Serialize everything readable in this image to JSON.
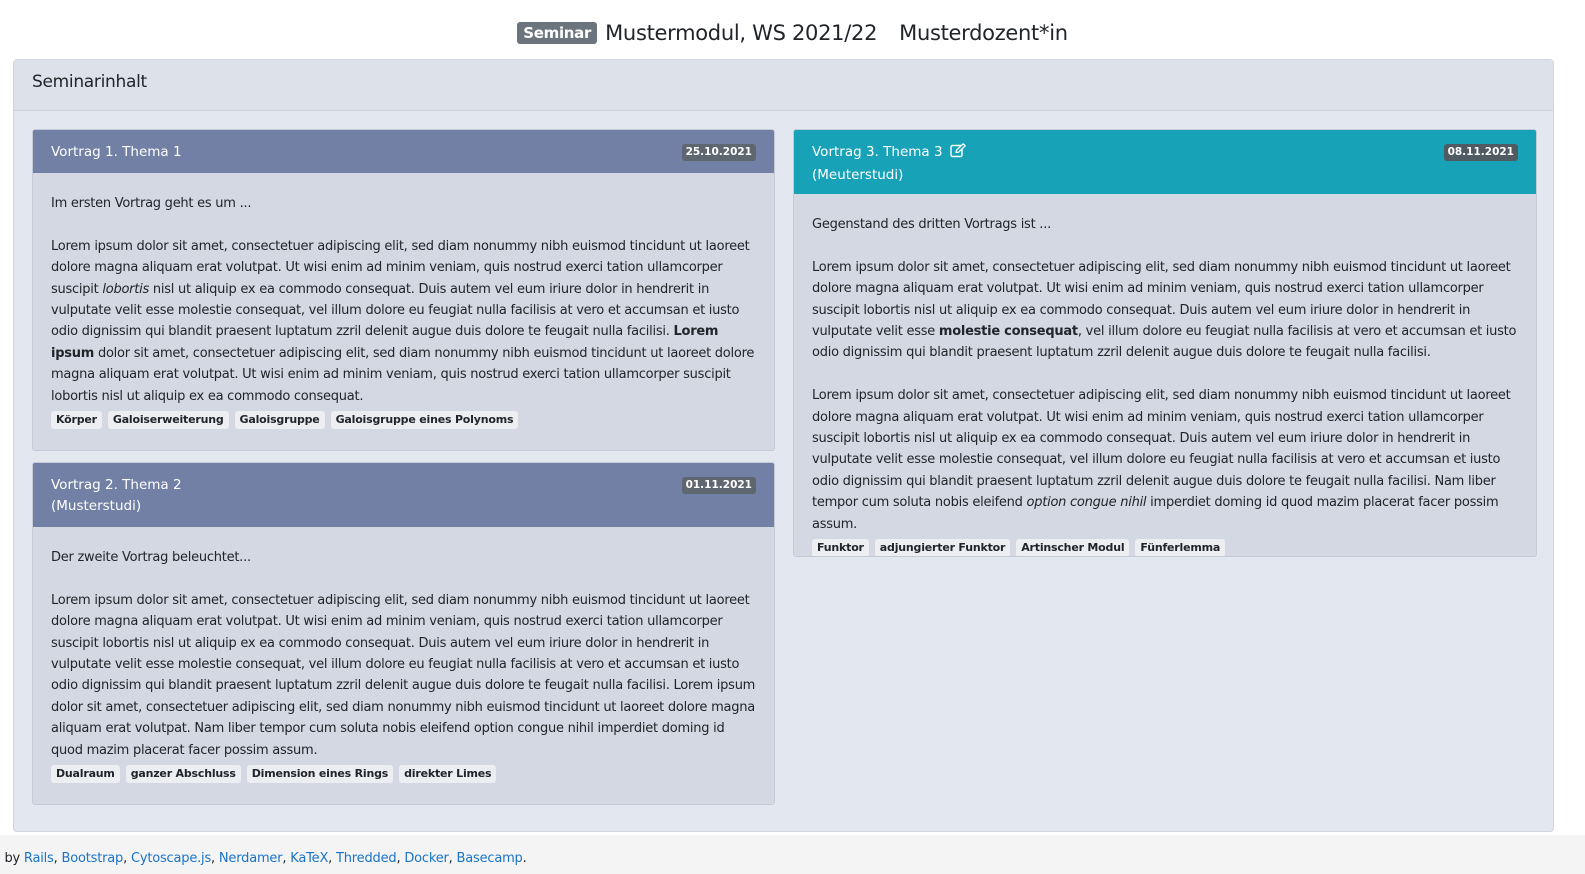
{
  "header": {
    "badge": "Seminar",
    "course": "Mustermodul, WS 2021/22",
    "teacher": "Musterdozent*in"
  },
  "card_title": "Seminarinhalt",
  "talks": [
    {
      "title": "Vortrag 1. Thema 1",
      "speaker": "",
      "date": "25.10.2021",
      "intro": "Im ersten Vortrag geht es um ...",
      "p_a1": "Lorem ipsum dolor sit amet, consectetuer adipiscing elit, sed diam nonummy nibh euismod tincidunt ut laoreet dolore magna aliquam erat volutpat. Ut wisi enim ad minim veniam, quis nostrud exerci tation ullamcorper suscipit ",
      "p_em": "lobortis",
      "p_a2": " nisl ut aliquip ex ea commodo consequat. Duis autem vel eum iriure dolor in hendrerit in vulputate velit esse molestie consequat, vel illum dolore eu feugiat nulla facilisis at vero et accumsan et iusto odio dignissim qui blandit praesent luptatum zzril delenit augue duis dolore te feugait nulla facilisi. ",
      "p_strong": "Lorem ipsum",
      "p_a3": " dolor sit amet, consectetuer adipiscing elit, sed diam nonummy nibh euismod tincidunt ut laoreet dolore magna aliquam erat volutpat. Ut wisi enim ad minim veniam, quis nostrud exerci tation ullamcorper suscipit lobortis nisl ut aliquip ex ea commodo consequat.",
      "tags": [
        "Körper",
        "Galoiserweiterung",
        "Galoisgruppe",
        "Galoisgruppe eines Polynoms"
      ]
    },
    {
      "title": "Vortrag 2. Thema 2",
      "speaker": "(Musterstudi)",
      "date": "01.11.2021",
      "intro": "Der zweite Vortrag beleuchtet...",
      "p": "Lorem ipsum dolor sit amet, consectetuer adipiscing elit, sed diam nonummy nibh euismod tincidunt ut laoreet dolore magna aliquam erat volutpat. Ut wisi enim ad minim veniam, quis nostrud exerci tation ullamcorper suscipit lobortis nisl ut aliquip ex ea commodo consequat. Duis autem vel eum iriure dolor in hendrerit in vulputate velit esse molestie consequat, vel illum dolore eu feugiat nulla facilisis at vero et accumsan et iusto odio dignissim qui blandit praesent luptatum zzril delenit augue duis dolore te feugait nulla facilisi. Lorem ipsum dolor sit amet, consectetuer adipiscing elit, sed diam nonummy nibh euismod tincidunt ut laoreet dolore magna aliquam erat volutpat. Nam liber tempor cum soluta nobis eleifend option congue nihil imperdiet doming id quod mazim placerat facer possim assum.",
      "tags": [
        "Dualraum",
        "ganzer Abschluss",
        "Dimension eines Rings",
        "direkter Limes"
      ]
    },
    {
      "title": "Vortrag 3. Thema 3",
      "speaker": "(Meuterstudi)",
      "date": "08.11.2021",
      "intro": "Gegenstand des dritten Vortrags ist ...",
      "p1_a": "Lorem ipsum dolor sit amet, consectetuer adipiscing elit, sed diam nonummy nibh euismod tincidunt ut laoreet dolore magna aliquam erat volutpat. Ut wisi enim ad minim veniam, quis nostrud exerci tation ullamcorper suscipit lobortis nisl ut aliquip ex ea commodo consequat. Duis autem vel eum iriure dolor in hendrerit in vulputate velit esse ",
      "p1_strong": "molestie consequat",
      "p1_b": ", vel illum dolore eu feugiat nulla facilisis at vero et accumsan et iusto odio dignissim qui blandit praesent luptatum zzril delenit augue duis dolore te feugait nulla facilisi.",
      "p2_a": "Lorem ipsum dolor sit amet, consectetuer adipiscing elit, sed diam nonummy nibh euismod tincidunt ut laoreet dolore magna aliquam erat volutpat. Ut wisi enim ad minim veniam, quis nostrud exerci tation ullamcorper suscipit lobortis nisl ut aliquip ex ea commodo consequat. Duis autem vel eum iriure dolor in hendrerit in vulputate velit esse molestie consequat, vel illum dolore eu feugiat nulla facilisis at vero et accumsan et iusto odio dignissim qui blandit praesent luptatum zzril delenit augue duis dolore te feugait nulla facilisi. Nam liber tempor cum soluta nobis eleifend ",
      "p2_em": "option congue nihil",
      "p2_b": " imperdiet doming id quod mazim placerat facer possim assum.",
      "tags": [
        "Funktor",
        "adjungierter Funktor",
        "Artinscher Modul",
        "Fünferlemma"
      ]
    }
  ],
  "footer": {
    "prefix": "ered by ",
    "links": [
      "Rails",
      "Bootstrap",
      "Cytoscape.js",
      "Nerdamer",
      "KaTeX",
      "Thredded",
      "Docker",
      "Basecamp"
    ],
    "sep": ", ",
    "end": "."
  }
}
